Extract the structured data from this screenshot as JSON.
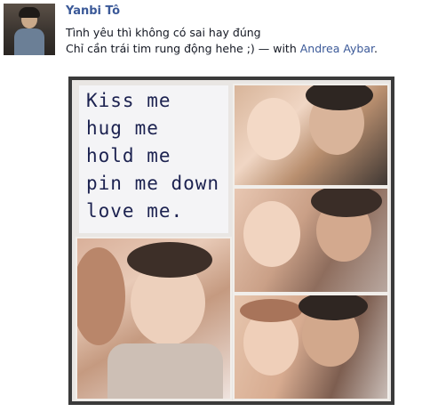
{
  "post": {
    "author": "Yanbi Tô",
    "line1": "Tình yêu thì không có sai hay đúng",
    "line2_prefix": "Chỉ cần trái tim rung động hehe ;) — with ",
    "tagged_user": "Andrea Aybar",
    "line2_suffix": "."
  },
  "photo": {
    "note_lines": [
      "Kiss me",
      "hug me",
      "hold me",
      "pin me down",
      "love me."
    ]
  }
}
